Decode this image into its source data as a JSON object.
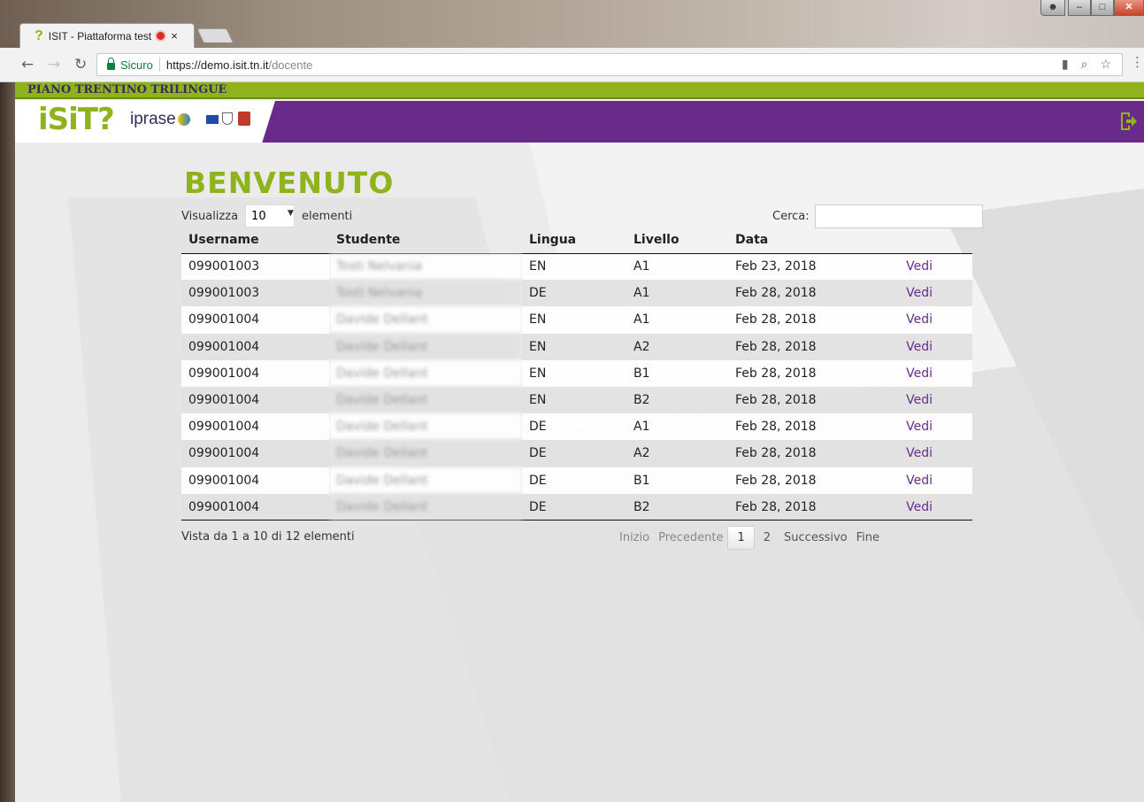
{
  "browser": {
    "tab_title": "ISIT - Piattaforma test",
    "tab_close": "×",
    "secure_label": "Sicuro",
    "url_host": "https://demo.isit.tn.it",
    "url_path": "/docente"
  },
  "header": {
    "program_title": "PIANO TRENTINO TRILINGUE",
    "logo_isit": "iSiT?",
    "logo_iprase": "iprase"
  },
  "page": {
    "title": "BENVENUTO",
    "length_prefix": "Visualizza",
    "length_value": "10",
    "length_suffix": "elementi",
    "search_label": "Cerca:",
    "search_value": ""
  },
  "table": {
    "headers": [
      "Username",
      "Studente",
      "Lingua",
      "Livello",
      "Data"
    ],
    "rows": [
      {
        "username": "099001003",
        "studente": "Tosti Nelvania",
        "lingua": "EN",
        "livello": "A1",
        "data": "Feb 23, 2018",
        "action": "Vedi"
      },
      {
        "username": "099001003",
        "studente": "Tosti Nelvania",
        "lingua": "DE",
        "livello": "A1",
        "data": "Feb 28, 2018",
        "action": "Vedi"
      },
      {
        "username": "099001004",
        "studente": "Davide Dellant",
        "lingua": "EN",
        "livello": "A1",
        "data": "Feb 28, 2018",
        "action": "Vedi"
      },
      {
        "username": "099001004",
        "studente": "Davide Dellant",
        "lingua": "EN",
        "livello": "A2",
        "data": "Feb 28, 2018",
        "action": "Vedi"
      },
      {
        "username": "099001004",
        "studente": "Davide Dellant",
        "lingua": "EN",
        "livello": "B1",
        "data": "Feb 28, 2018",
        "action": "Vedi"
      },
      {
        "username": "099001004",
        "studente": "Davide Dellant",
        "lingua": "EN",
        "livello": "B2",
        "data": "Feb 28, 2018",
        "action": "Vedi"
      },
      {
        "username": "099001004",
        "studente": "Davide Dellant",
        "lingua": "DE",
        "livello": "A1",
        "data": "Feb 28, 2018",
        "action": "Vedi"
      },
      {
        "username": "099001004",
        "studente": "Davide Dellant",
        "lingua": "DE",
        "livello": "A2",
        "data": "Feb 28, 2018",
        "action": "Vedi"
      },
      {
        "username": "099001004",
        "studente": "Davide Dellant",
        "lingua": "DE",
        "livello": "B1",
        "data": "Feb 28, 2018",
        "action": "Vedi"
      },
      {
        "username": "099001004",
        "studente": "Davide Dellant",
        "lingua": "DE",
        "livello": "B2",
        "data": "Feb 28, 2018",
        "action": "Vedi"
      }
    ]
  },
  "pagination": {
    "info": "Vista da 1 a 10 di 12 elementi",
    "first": "Inizio",
    "previous": "Precedente",
    "page1": "1",
    "page2": "2",
    "next": "Successivo",
    "last": "Fine"
  },
  "colors": {
    "brand_green": "#8fb31c",
    "brand_purple": "#6a2a8a"
  }
}
